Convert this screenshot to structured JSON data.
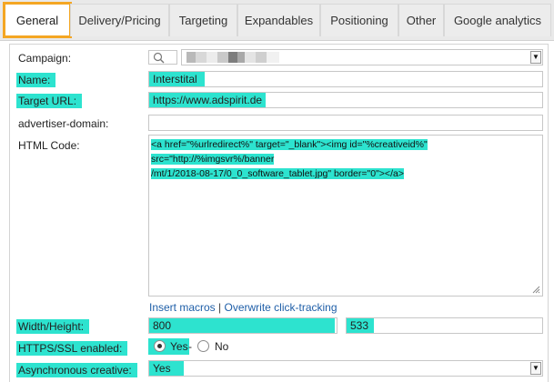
{
  "tabs": [
    {
      "label": "General",
      "active": true
    },
    {
      "label": "Delivery/Pricing"
    },
    {
      "label": "Targeting"
    },
    {
      "label": "Expandables"
    },
    {
      "label": "Positioning"
    },
    {
      "label": "Other"
    },
    {
      "label": "Google analytics"
    }
  ],
  "form": {
    "campaign_label": "Campaign:",
    "name_label": "Name:",
    "name_value": "Interstital",
    "target_url_label": "Target URL:",
    "target_url_value": "https://www.adspirit.de",
    "advertiser_domain_label": "advertiser-domain:",
    "advertiser_domain_value": "",
    "html_code_label": "HTML Code:",
    "html_code_line1": "<a href=\"%urlredirect%\" target=\"_blank\"><img id=\"%creativeid%\" src=\"http://%imgsvr%/banner",
    "html_code_line2": "/mt/1/2018-08-17/0_0_software_tablet.jpg\" border=\"0\"></a>",
    "insert_macros_link": "Insert macros",
    "link_separator": "|",
    "overwrite_link": "Overwrite click-tracking",
    "width_height_label": "Width/Height:",
    "width_value": "800",
    "height_value": "533",
    "https_label": "HTTPS/SSL enabled:",
    "https_yes": "Yes",
    "https_dash": "-",
    "https_no": "No",
    "https_selected": "Yes",
    "async_label": "Asynchronous creative:",
    "async_value": "Yes"
  },
  "colors": {
    "highlight": "#2de3cf",
    "active_tab_outline": "#f4a623",
    "link": "#1f5fa8"
  },
  "icons": {
    "campaign_search": "search-icon",
    "select_arrow": "chevron-down-icon",
    "resize_handle": "resize-grip-icon"
  }
}
